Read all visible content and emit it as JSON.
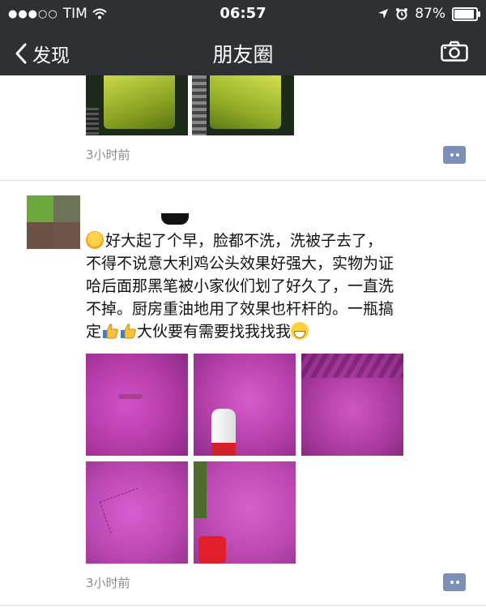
{
  "status_bar": {
    "carrier": "TIM",
    "time": "06:57",
    "battery": "87%",
    "battery_level": 0.87
  },
  "nav": {
    "back_label": "发现",
    "title": "朋友圈"
  },
  "posts": [
    {
      "time": "3小时前"
    },
    {
      "text_lines": [
        "好大起了个早，脸都不洗，洗被子去了，",
        "不得不说意大利鸡公头效果好强大，实物为证",
        "哈后面那黑笔被小家伙们划了好久了，一直洗",
        "不掉。厨房重油地用了效果也杆杆的。一瓶搞",
        "定",
        "大伙要有需要找我找我"
      ],
      "time": "3小时前"
    }
  ],
  "icons": {
    "back": "chevron-left-icon",
    "camera": "camera-icon",
    "comment": "comment-icon",
    "sun": "sun-emoji",
    "thumb": "thumbs-up-emoji",
    "grin": "grin-emoji"
  },
  "colors": {
    "bar": "#2e3133",
    "comment_button": "#7d8fb7",
    "timestamp": "#8a8a8a"
  }
}
